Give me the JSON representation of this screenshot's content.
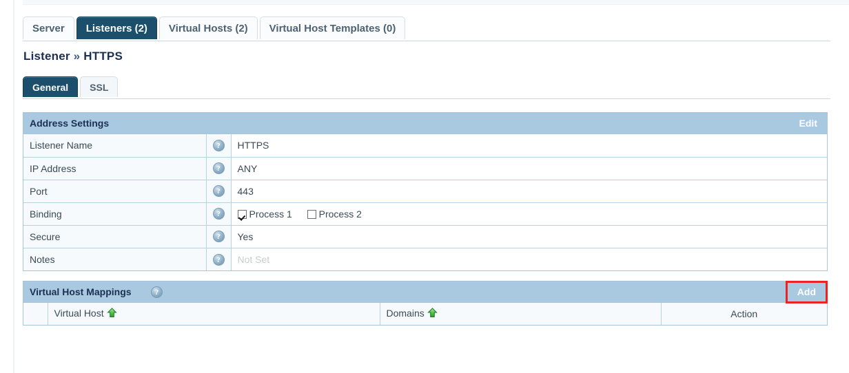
{
  "tabs": [
    {
      "label": "Server",
      "active": false
    },
    {
      "label": "Listeners (2)",
      "active": true
    },
    {
      "label": "Virtual Hosts (2)",
      "active": false
    },
    {
      "label": "Virtual Host Templates (0)",
      "active": false
    }
  ],
  "page_title": {
    "prefix": "Listener",
    "separator": "»",
    "name": "HTTPS"
  },
  "subtabs": [
    {
      "label": "General",
      "active": true
    },
    {
      "label": "SSL",
      "active": false
    }
  ],
  "address_settings": {
    "title": "Address Settings",
    "edit_label": "Edit",
    "rows": [
      {
        "label": "Listener Name",
        "value": "HTTPS",
        "muted": false
      },
      {
        "label": "IP Address",
        "value": "ANY",
        "muted": false
      },
      {
        "label": "Port",
        "value": "443",
        "muted": false
      },
      {
        "label": "Binding",
        "value": "",
        "muted": false,
        "checkboxes": [
          {
            "label": "Process 1",
            "checked": true
          },
          {
            "label": "Process 2",
            "checked": false
          }
        ]
      },
      {
        "label": "Secure",
        "value": "Yes",
        "muted": false
      },
      {
        "label": "Notes",
        "value": "Not Set",
        "muted": true
      }
    ]
  },
  "virtual_host_mappings": {
    "title": "Virtual Host Mappings",
    "add_label": "Add",
    "columns": [
      {
        "label": "",
        "sorted": false,
        "align": "left"
      },
      {
        "label": "Virtual Host",
        "sorted": true,
        "align": "left"
      },
      {
        "label": "Domains",
        "sorted": true,
        "align": "left"
      },
      {
        "label": "Action",
        "sorted": false,
        "align": "center"
      }
    ],
    "rows": []
  },
  "colors": {
    "active_tab": "#1b4f6b",
    "panel_header": "#a9c9e0",
    "border": "#a8c4d8",
    "sort_arrow": "#4cbb47",
    "highlight_box": "#ee2222",
    "title_text": "#1b2f52"
  }
}
